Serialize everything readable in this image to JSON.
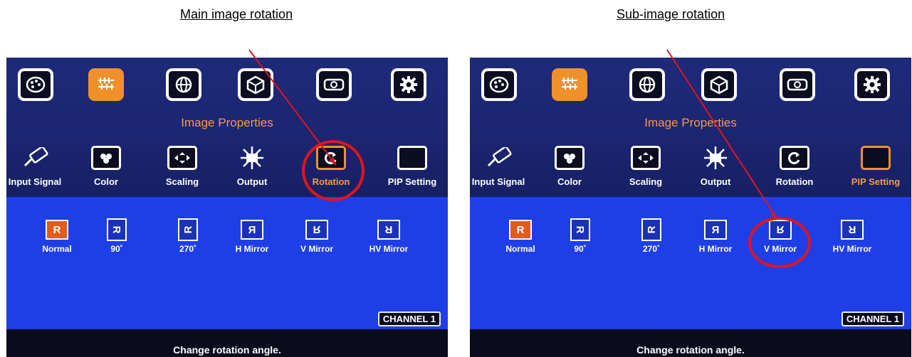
{
  "captions": {
    "left": "Main image rotation",
    "right": "Sub-image rotation"
  },
  "colors": {
    "accent_orange": "#f0902a",
    "highlight_red": "#e0141e",
    "menu_blue": "#1f3fe6"
  },
  "top_menu_icons": [
    "palette-icon",
    "image-properties-icon",
    "globe-icon",
    "3d-cube-icon",
    "projector-icon",
    "gear-icon"
  ],
  "panels": [
    {
      "section_title": "Image Properties",
      "submenu": [
        "Input Signal",
        "Color",
        "Scaling",
        "Output",
        "Rotation",
        "PIP Setting"
      ],
      "rotation_options": [
        "Normal",
        "90˚",
        "270˚",
        "H Mirror",
        "V Mirror",
        "HV Mirror"
      ],
      "rotation_icons": [
        "R",
        "R",
        "R",
        "R",
        "R",
        "R"
      ],
      "channel": "CHANNEL 1",
      "status": "Change rotation angle."
    },
    {
      "section_title": "Image Properties",
      "submenu": [
        "Input Signal",
        "Color",
        "Scaling",
        "Output",
        "Rotation",
        "PIP Setting"
      ],
      "rotation_options": [
        "Normal",
        "90˚",
        "270˚",
        "H Mirror",
        "V Mirror",
        "HV Mirror"
      ],
      "rotation_icons": [
        "R",
        "R",
        "R",
        "R",
        "R",
        "R"
      ],
      "channel": "CHANNEL 1",
      "status": "Change rotation angle."
    }
  ]
}
